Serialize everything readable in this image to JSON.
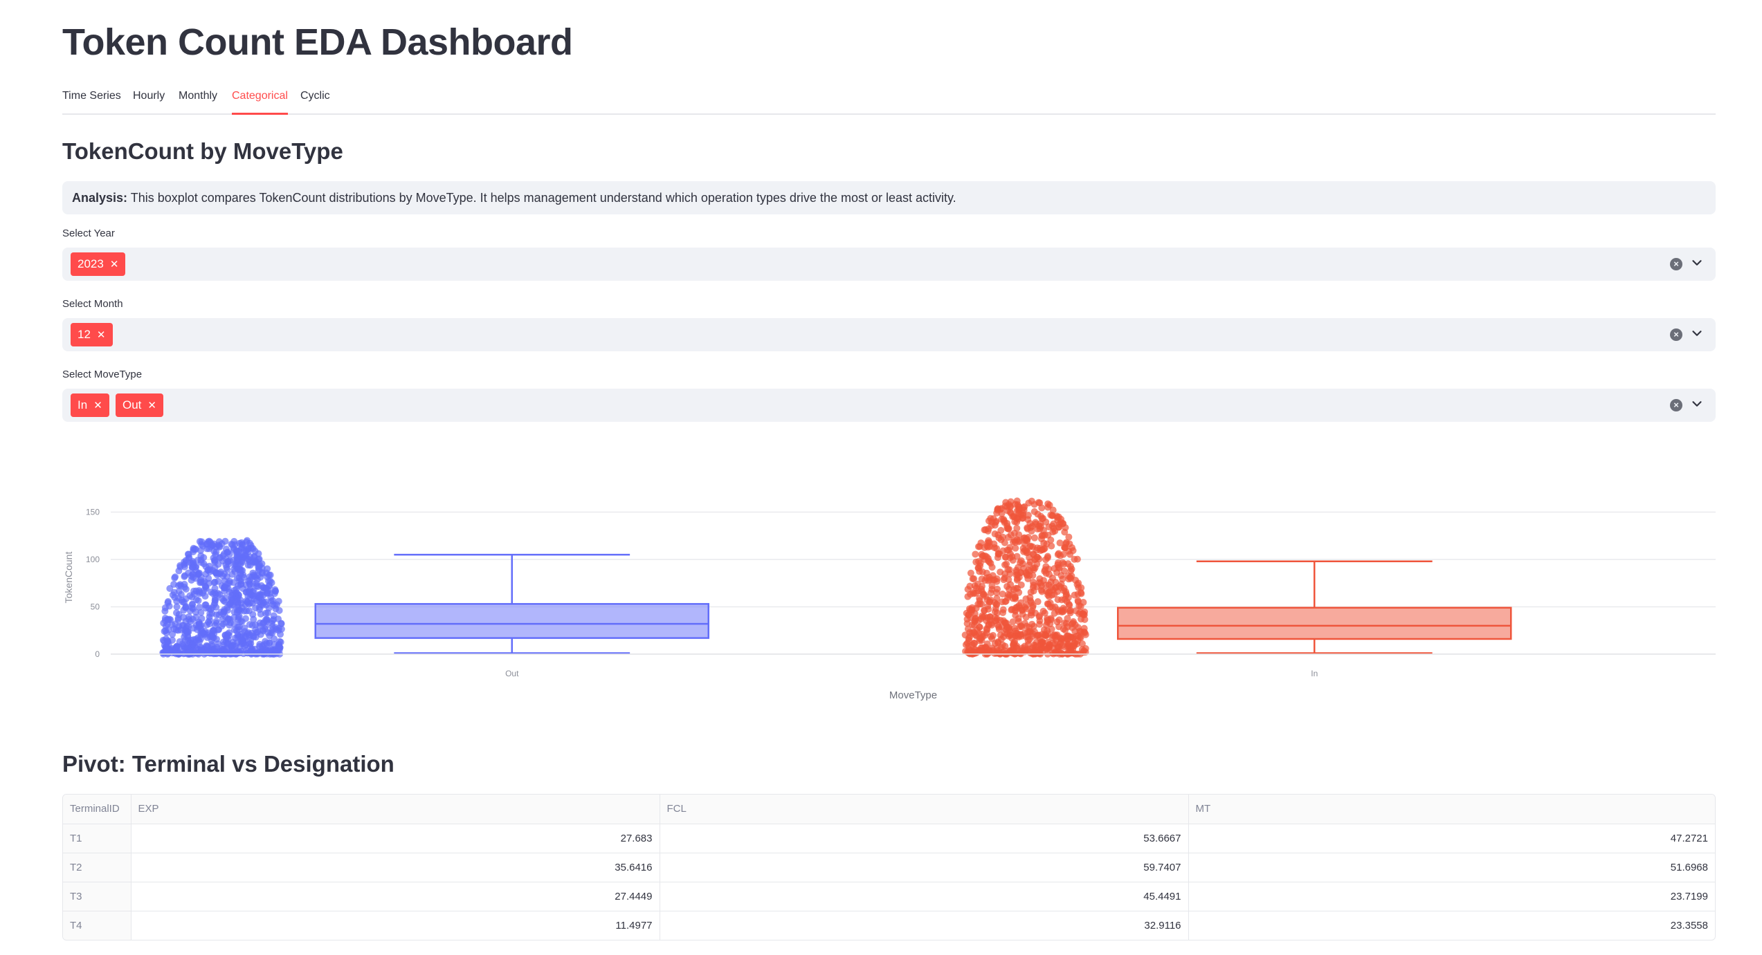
{
  "title": "Token Count EDA Dashboard",
  "tabs": [
    {
      "label": "Time Series",
      "active": false
    },
    {
      "label": "Hourly",
      "active": false
    },
    {
      "label": "Monthly",
      "active": false
    },
    {
      "label": "Categorical",
      "active": true
    },
    {
      "label": "Cyclic",
      "active": false
    }
  ],
  "section1": {
    "heading": "TokenCount by MoveType",
    "analysis_label": "Analysis:",
    "analysis_text": " This boxplot compares TokenCount distributions by MoveType. It helps management understand which operation types drive the most or least activity."
  },
  "filters": {
    "year": {
      "label": "Select Year",
      "chips": [
        "2023"
      ]
    },
    "month": {
      "label": "Select Month",
      "chips": [
        "12"
      ]
    },
    "movetype": {
      "label": "Select MoveType",
      "chips": [
        "In",
        "Out"
      ]
    }
  },
  "colors": {
    "accent": "#ff4b4b",
    "out_series": "#636efa",
    "in_series": "#ef553b"
  },
  "chart_data": {
    "type": "box",
    "xlabel": "MoveType",
    "ylabel": "TokenCount",
    "yticks": [
      0,
      50,
      100,
      150
    ],
    "ylim": [
      -3,
      165
    ],
    "categories": [
      "Out",
      "In"
    ],
    "series": [
      {
        "name": "Out",
        "color": "#636efa",
        "min": 1,
        "q1": 17,
        "median": 32,
        "q3": 53,
        "max": 105,
        "points_max": 120
      },
      {
        "name": "In",
        "color": "#ef553b",
        "min": 1,
        "q1": 16,
        "median": 30,
        "q3": 49,
        "max": 98,
        "points_max": 162
      }
    ]
  },
  "section2": {
    "heading": "Pivot: Terminal vs Designation"
  },
  "pivot": {
    "columns": [
      "TerminalID",
      "EXP",
      "FCL",
      "MT"
    ],
    "rows": [
      [
        "T1",
        "27.683",
        "53.6667",
        "47.2721"
      ],
      [
        "T2",
        "35.6416",
        "59.7407",
        "51.6968"
      ],
      [
        "T3",
        "27.4449",
        "45.4491",
        "23.7199"
      ],
      [
        "T4",
        "11.4977",
        "32.9116",
        "23.3558"
      ]
    ]
  }
}
